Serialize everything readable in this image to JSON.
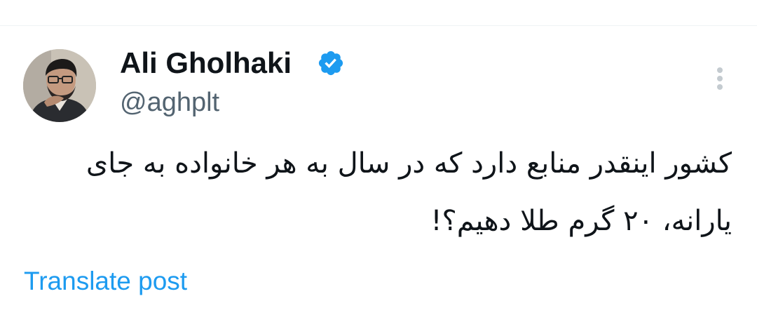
{
  "author": {
    "display_name": "Ali Gholhaki",
    "handle": "@aghplt",
    "verified": true,
    "verified_color": "#1d9bf0",
    "avatar_icon": "profile-photo"
  },
  "post": {
    "text": "کشور اینقدر منابع دارد که در سال به هر خانواده به جای یارانه، ۲۰ گرم طلا دهیم؟!"
  },
  "actions": {
    "more_icon": "more-vertical-icon",
    "translate_label": "Translate post",
    "link_color": "#1d9bf0"
  }
}
